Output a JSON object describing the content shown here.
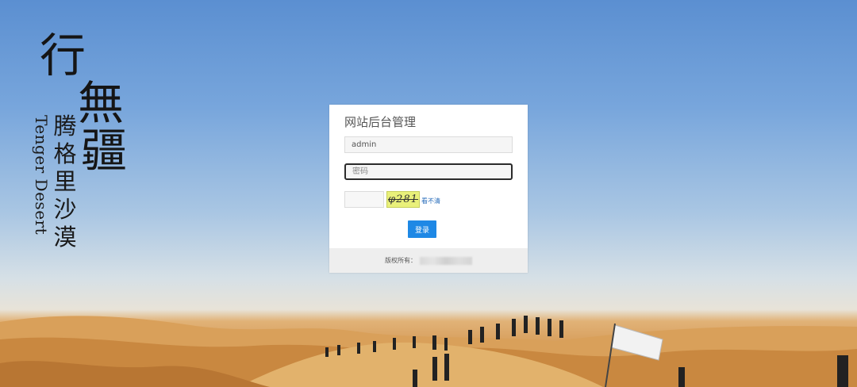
{
  "background": {
    "calligraphy_title": [
      "行",
      "無",
      "疆"
    ],
    "chinese_name": [
      "腾",
      "格",
      "里",
      "沙",
      "漠"
    ],
    "english_name": "Tenger Desert"
  },
  "login": {
    "title": "网站后台管理",
    "username_value": "admin",
    "password_placeholder": "密码",
    "captcha_text": "φ281",
    "captcha_refresh_link": "看不清",
    "submit_label": "登录"
  },
  "footer": {
    "copyright_label": "版权所有："
  },
  "colors": {
    "accent": "#1e88e5",
    "link": "#2a6ebb",
    "captcha_bg": "#e9f07a"
  }
}
